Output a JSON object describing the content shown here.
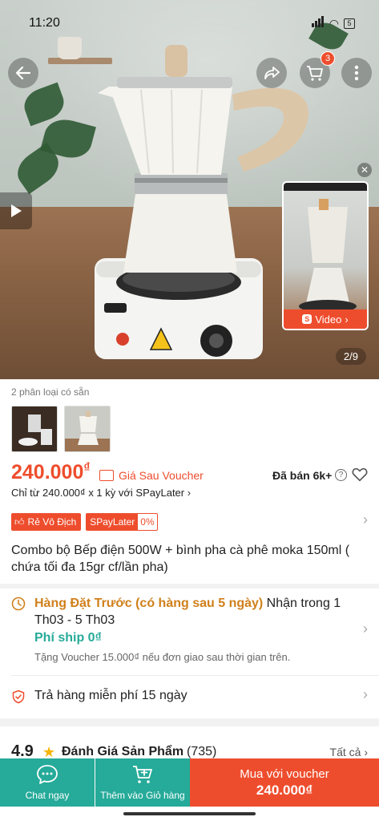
{
  "status_bar": {
    "time": "11:20",
    "battery": "5"
  },
  "header": {
    "cart_count": "3"
  },
  "gallery": {
    "page_indicator": "2/9",
    "video_label": "Video"
  },
  "variants": {
    "label": "2 phân loại có sẵn"
  },
  "price": {
    "amount": "240.000",
    "currency": "₫",
    "voucher_label": "Giá Sau Voucher",
    "sold": "Đã bán 6k+",
    "installment": "Chỉ từ 240.000₫ x 1 kỳ với SPayLater"
  },
  "badges": {
    "cheapest": "Rẻ Vô Địch",
    "spaylater": "SPayLater",
    "spaylater_rate": "0%"
  },
  "product": {
    "title": "Combo bộ Bếp điện 500W + bình pha cà phê moka 150ml ( chứa tối đa 15gr cf/lần pha)"
  },
  "shipping": {
    "preorder": "Hàng Đặt Trước (có hàng sau 5 ngày)",
    "delivery": " Nhận trong 1 Th03 - 5 Th03",
    "fee": "Phí ship 0₫",
    "note": "Tặng Voucher 15.000₫ nếu đơn giao sau thời gian trên."
  },
  "returns": {
    "text": "Trả hàng miễn phí 15 ngày"
  },
  "rating": {
    "score": "4.9",
    "title": "Đánh Giá Sản Phẩm",
    "count": "(735)",
    "view_all": "Tất cả"
  },
  "bottom_bar": {
    "chat": "Chat ngay",
    "add_cart": "Thêm vào Giỏ hàng",
    "buy_line1": "Mua với voucher",
    "buy_line2": "240.000₫"
  },
  "colors": {
    "brand": "#ee4d2d",
    "teal": "#26aa99",
    "preorder": "#d0801b"
  }
}
